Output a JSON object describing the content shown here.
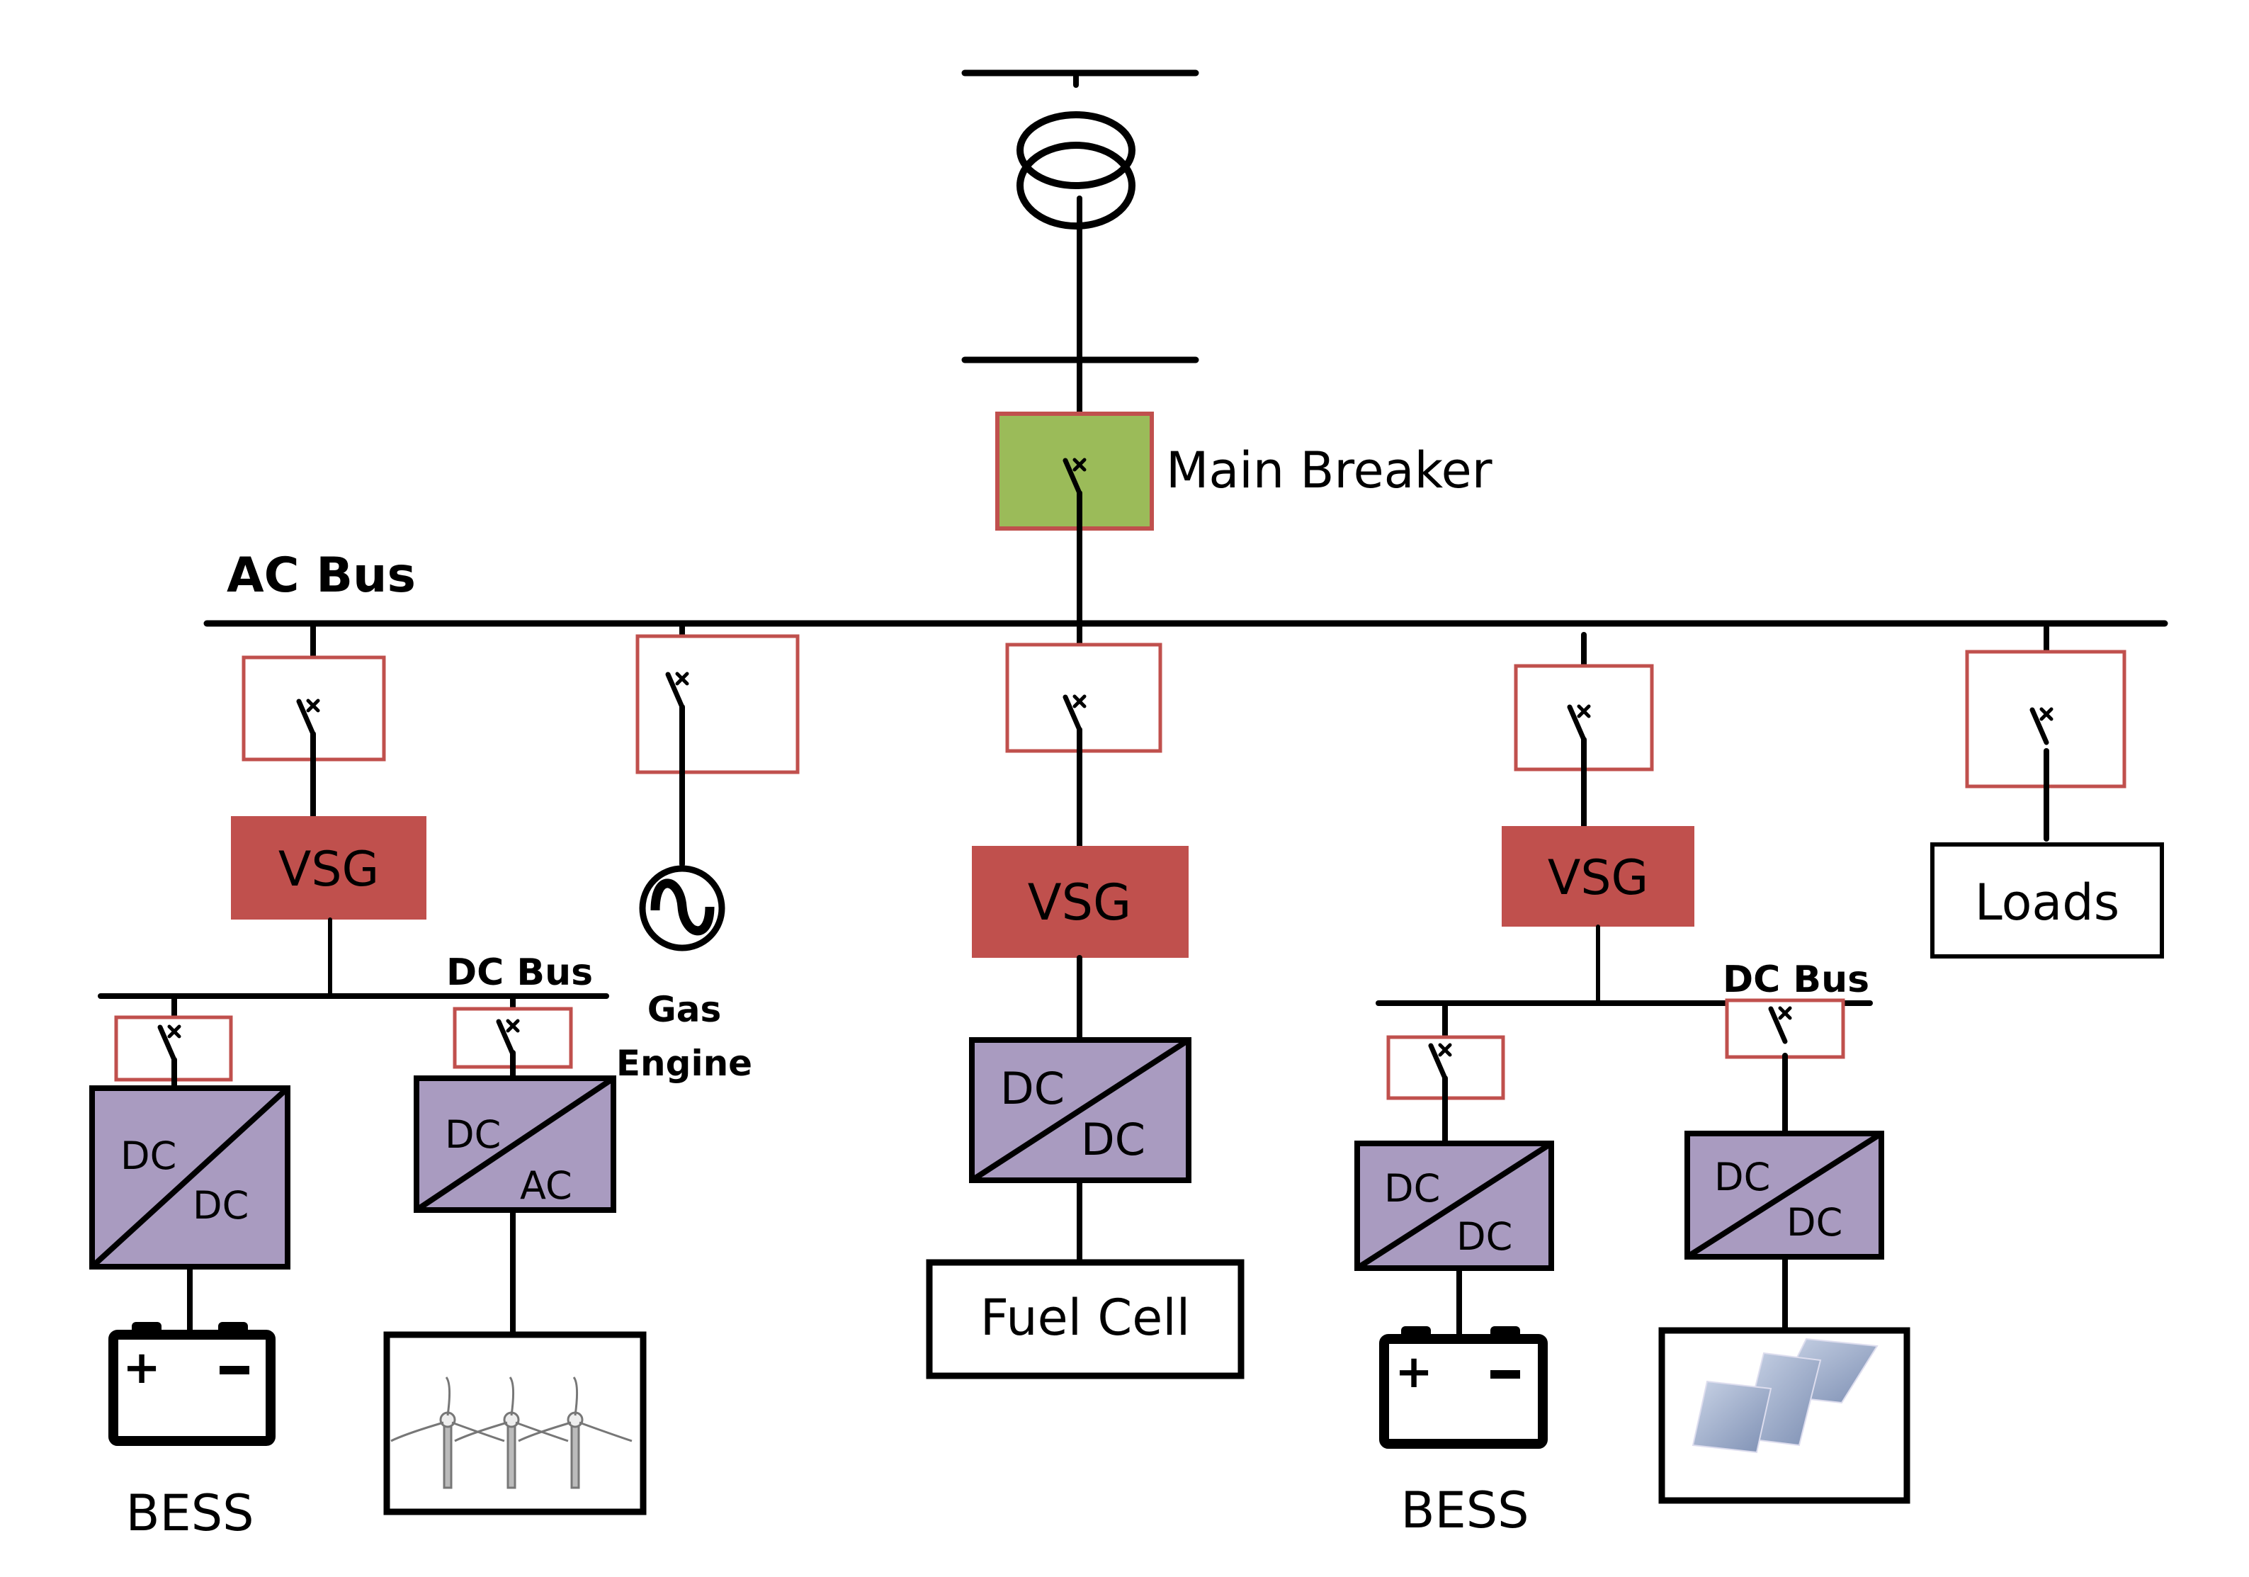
{
  "diagram": {
    "type": "microgrid single-line diagram",
    "colors": {
      "breaker_border": "#c0504d",
      "main_breaker_fill": "#9bbb59",
      "vsg_fill": "#c0504d",
      "converter_fill": "#a99bc0",
      "line": "#000000"
    },
    "labels": {
      "main_breaker": "Main Breaker",
      "ac_bus": "AC Bus",
      "dc_bus_left": "DC Bus",
      "dc_bus_right": "DC Bus",
      "vsg_1": "VSG",
      "vsg_2": "VSG",
      "vsg_3": "VSG",
      "gas_engine_line1": "Gas",
      "gas_engine_line2": "Engine",
      "loads": "Loads",
      "fuel_cell": "Fuel Cell",
      "bess_left": "BESS",
      "bess_right": "BESS",
      "battery_plus": "+",
      "battery_minus": "−"
    },
    "converters": [
      {
        "id": "conv-bess-left",
        "top": "DC",
        "bottom": "DC"
      },
      {
        "id": "conv-wind",
        "top": "DC",
        "bottom": "AC"
      },
      {
        "id": "conv-fuelcell",
        "top": "DC",
        "bottom": "DC"
      },
      {
        "id": "conv-bess-right",
        "top": "DC",
        "bottom": "DC"
      },
      {
        "id": "conv-pv",
        "top": "DC",
        "bottom": "DC"
      }
    ],
    "icons": [
      "transformer-icon",
      "circuit-breaker-icon",
      "ac-generator-icon",
      "battery-icon",
      "wind-turbine-icon",
      "solar-panel-icon"
    ]
  }
}
